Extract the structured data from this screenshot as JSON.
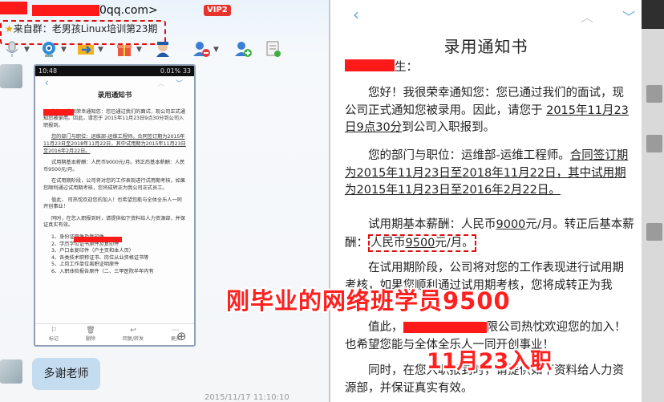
{
  "chat": {
    "email_suffix": "0qq.com>",
    "vip_badge": "VIP2",
    "group_prefix": "★",
    "group_line": "来自群：老男孩Linux培训第23期",
    "message": "多谢老师",
    "timestamp": "2015/11/17 11:10:10",
    "toolbar_icons": [
      "microphone-icon",
      "camera-icon",
      "transfer-icon",
      "gift-icon",
      "remove-user-icon",
      "add-user-icon",
      "note-icon"
    ]
  },
  "phone": {
    "status_time": "10:48",
    "status_right": "0.01% 33",
    "title": "录用通知书",
    "paragraphs": [
      "您好！我很荣幸通知您：您已通过我们的面试，现公司正式通知您被录用。因此，请您于 2015年11月23日9点30分到公司入职报到。",
      "您的部门与职位：运维部-运维工程师。合同签订期为2015年11月23日至2018年11月22日，其中试用期为2015年11月23日至2016年2月22日。",
      "试用期基本薪酬：人民币9000元/月。转正后基本薪酬：人民币9500元/月。",
      "在试用期阶段，公司将对您的工作表现进行试用期考核，如果您顺利通过试用期考核，您将成转正为我公司正式员工。",
      "值此，     司热忱欢迎您的加入！也希望您能与全体全乐人一同开创事业！",
      "同时，在您入职报到时，请提供如下资料给人力资源部，并保证真实有效。",
      "1、身份证原件及复印件",
      "2、学历学位证书原件及复印件",
      "3、户口本复印件（户主页和本人页）",
      "4、各类技术职称证书、岗位从业资格证书等",
      "5、上岗工作单位离职证明原件",
      "6、入职体检报告原件（二、三甲医院半年内有"
    ],
    "bottom_bar": [
      {
        "icon": "⚐",
        "label": "标记"
      },
      {
        "icon": "🗑",
        "label": "删除"
      },
      {
        "icon": "↩",
        "label": "回复/转发"
      },
      {
        "icon": "⋯",
        "label": "更多"
      }
    ]
  },
  "doc": {
    "title": "录用通知书",
    "salute_suffix": "生：",
    "p1_a": "您好！我很荣幸通知您：您已通过我们的面试，现公司正式通知您被录用。因此，请您于",
    "p1_date": "2015年11月23日9点30分",
    "p1_b": "到公司入职报到。",
    "p2_a": "您的部门与职位：运维部-运维工程师。",
    "p2_u": "合同签订期为2015年11月23日至2018年11月22日，其中试用期为2015年11月23日至2016年2月22日。",
    "p3_a": "试用期基本薪酬：人民币",
    "p3_salary1": "9000",
    "p3_b": "元/月。转正后基本薪酬：",
    "p3_boxed_pre": "人民币",
    "p3_salary2": "9500",
    "p3_boxed_post": "元/月。",
    "p4": "在试用期阶段，公司将对您的工作表现进行试用期考核，如果您顺利通过试用期考核，您将成转正为我",
    "p5_a": "值此，",
    "p5_b": "限公司热忱欢迎您的加入！也希望您能与全体全乐人一同开创事业！",
    "p6": "同时，在您入职报到时，请提供如下资料给人力资源部，并保证真实有效。"
  },
  "overlays": {
    "line1": "刚毕业的网络班学员9500",
    "line2": "11月23入职"
  },
  "colors": {
    "redact": "#ff1a1a",
    "accent_blue": "#58a6dc",
    "bubble": "#c4dcf0"
  }
}
